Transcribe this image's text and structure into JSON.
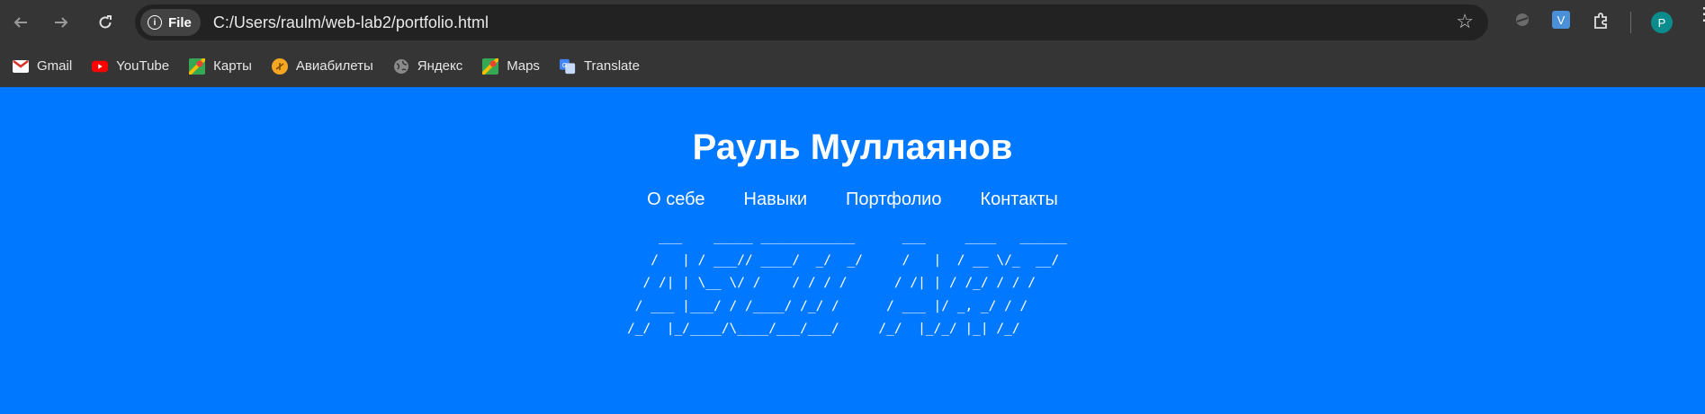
{
  "browser": {
    "back_icon": "arrow-left-icon",
    "forward_icon": "arrow-right-icon",
    "reload_icon": "reload-icon",
    "site_chip": "File",
    "url": "C:/Users/raulm/web-lab2/portfolio.html",
    "profile_initial": "P",
    "extension_letter": "V"
  },
  "bookmarks": [
    {
      "label": "Gmail"
    },
    {
      "label": "YouTube"
    },
    {
      "label": "Карты"
    },
    {
      "label": "Авиабилеты"
    },
    {
      "label": "Яндекс"
    },
    {
      "label": "Maps"
    },
    {
      "label": "Translate"
    }
  ],
  "page": {
    "title": "Рауль Муллаянов",
    "nav": [
      "О себе",
      "Навыки",
      "Портфолио",
      "Контакты"
    ],
    "ascii_art": "    ___    _____ ____________      ___     ____   ______\n   /   | / ___// ____/  _/  _/     /   |  / __ \\/_  __/\n  / /| | \\__ \\/ /    / / / /      / /| | / /_/ / / /   \n / ___ |___/ / /____/ /_/ /      / ___ |/ _, _/ / /    \n/_/  |_/____/\\____/___/___/     /_/  |_/_/ |_| /_/     "
  },
  "colors": {
    "page_bg": "#0078ff",
    "chrome_bg": "#353535",
    "omnibox_bg": "#222222",
    "avatar_bg": "#0b8c8c"
  }
}
